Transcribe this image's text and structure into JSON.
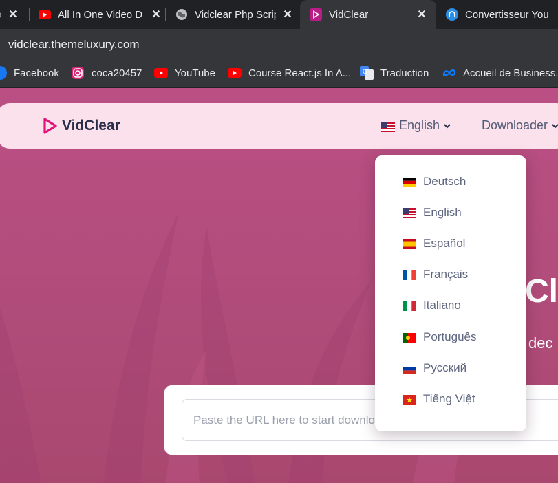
{
  "browser": {
    "tabs": [
      {
        "title": "All In One Video D",
        "icon": "youtube-icon",
        "active": false
      },
      {
        "title": "Vidclear Php Scrip",
        "icon": "globe-icon",
        "active": false
      },
      {
        "title": "VidClear",
        "icon": "vidclear-icon",
        "active": true
      },
      {
        "title": "Convertisseur You",
        "icon": "converter-icon",
        "active": false
      }
    ],
    "url": "vidclear.themeluxury.com",
    "bookmarks": [
      {
        "label": "Facebook",
        "icon": "facebook-icon"
      },
      {
        "label": "coca20457",
        "icon": "instagram-icon"
      },
      {
        "label": "YouTube",
        "icon": "youtube-icon"
      },
      {
        "label": "Course React.js In A...",
        "icon": "youtube-icon"
      },
      {
        "label": "Traduction",
        "icon": "google-translate-icon"
      },
      {
        "label": "Accueil de Business...",
        "icon": "meta-icon"
      }
    ]
  },
  "site": {
    "logo": "VidClear",
    "nav": {
      "language": "English",
      "downloader": "Downloader"
    },
    "hero": {
      "title_partial": "Cl",
      "subtitle_partial": "dec"
    },
    "search": {
      "placeholder": "Paste the URL here to start download"
    },
    "languages": [
      {
        "label": "Deutsch",
        "flag": "de"
      },
      {
        "label": "English",
        "flag": "us"
      },
      {
        "label": "Español",
        "flag": "es"
      },
      {
        "label": "Français",
        "flag": "fr"
      },
      {
        "label": "Italiano",
        "flag": "it"
      },
      {
        "label": "Português",
        "flag": "pt"
      },
      {
        "label": "Русский",
        "flag": "ru"
      },
      {
        "label": "Tiếng Việt",
        "flag": "vn"
      }
    ]
  },
  "colors": {
    "brand": "#e0147a",
    "page_bg": "#b24d7c",
    "navbar_bg": "#fbe1ec",
    "text_dark": "#2a2e4a"
  }
}
